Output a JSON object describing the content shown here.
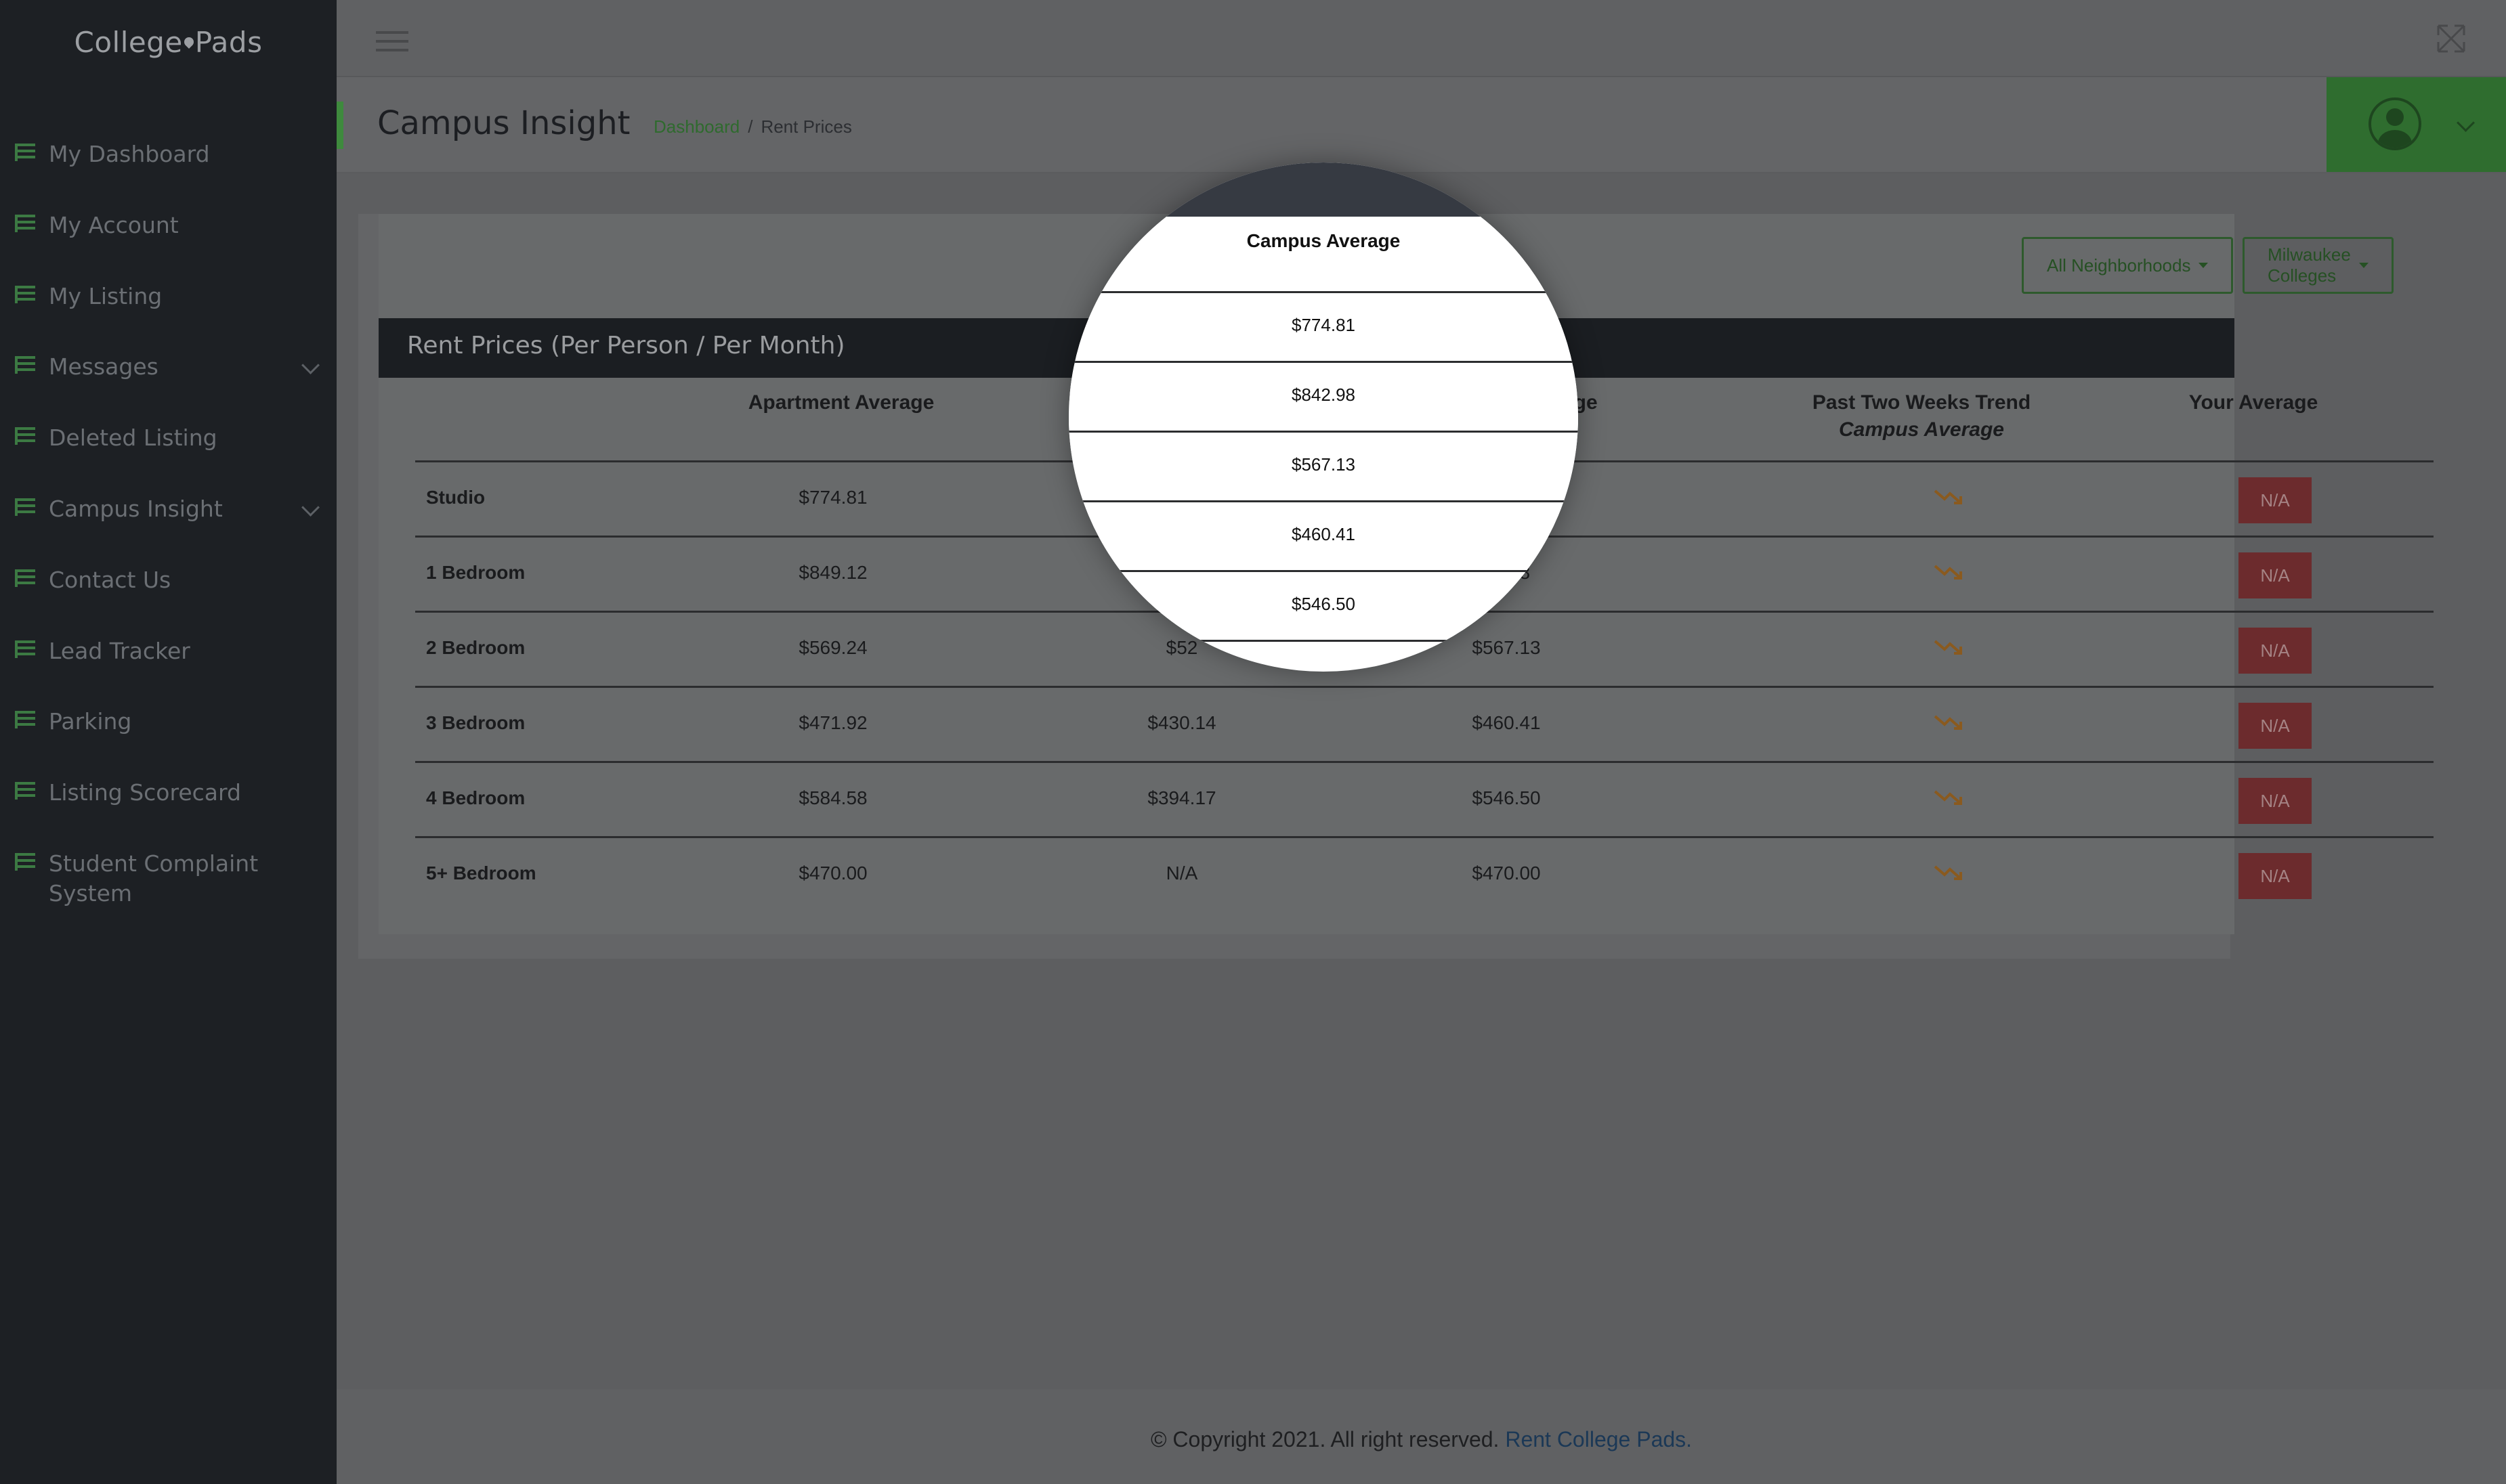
{
  "app": {
    "logo_text_left": "College",
    "logo_text_right": "Pads"
  },
  "sidebar": {
    "items": [
      {
        "label": "My Dashboard",
        "icon": "list-icon",
        "has_chevron": false
      },
      {
        "label": "My Account",
        "icon": "list-icon",
        "has_chevron": false
      },
      {
        "label": "My Listing",
        "icon": "list-icon",
        "has_chevron": false
      },
      {
        "label": "Messages",
        "icon": "list-icon",
        "has_chevron": true
      },
      {
        "label": "Deleted Listing",
        "icon": "list-icon",
        "has_chevron": false
      },
      {
        "label": "Campus Insight",
        "icon": "list-icon",
        "has_chevron": true
      },
      {
        "label": "Contact Us",
        "icon": "list-icon",
        "has_chevron": false
      },
      {
        "label": "Lead Tracker",
        "icon": "list-icon",
        "has_chevron": false
      },
      {
        "label": "Parking",
        "icon": "list-icon",
        "has_chevron": false
      },
      {
        "label": "Listing Scorecard",
        "icon": "list-icon",
        "has_chevron": false
      },
      {
        "label": "Student Complaint System",
        "icon": "list-icon",
        "has_chevron": false
      }
    ]
  },
  "header": {
    "title": "Campus Insight",
    "breadcrumb_link": "Dashboard",
    "breadcrumb_sep": "/",
    "breadcrumb_current": "Rent Prices"
  },
  "filters": {
    "neighborhoods": "All Neighborhoods",
    "colleges": "Milwaukee Colleges"
  },
  "table": {
    "title": "Rent Prices (Per Person / Per Month)",
    "columns": {
      "apartment": "Apartment Average",
      "campus_partial": "rage",
      "trend_line1": "Past Two Weeks Trend",
      "trend_line2": "Campus Average",
      "yours": "Your Average"
    },
    "rows": [
      {
        "label": "Studio",
        "apartment": "$774.81",
        "third": "",
        "campus": "1",
        "yours": "N/A"
      },
      {
        "label": "1 Bedroom",
        "apartment": "$849.12",
        "third": "",
        "campus": "42.98",
        "yours": "N/A"
      },
      {
        "label": "2 Bedroom",
        "apartment": "$569.24",
        "third": "$52",
        "campus": "$567.13",
        "yours": "N/A"
      },
      {
        "label": "3 Bedroom",
        "apartment": "$471.92",
        "third": "$430.14",
        "campus": "$460.41",
        "yours": "N/A"
      },
      {
        "label": "4 Bedroom",
        "apartment": "$584.58",
        "third": "$394.17",
        "campus": "$546.50",
        "yours": "N/A"
      },
      {
        "label": "5+ Bedroom",
        "apartment": "$470.00",
        "third": "N/A",
        "campus": "$470.00",
        "yours": "N/A"
      }
    ]
  },
  "magnifier": {
    "header": "Campus Average",
    "values": [
      "$774.81",
      "$842.98",
      "$567.13",
      "$460.41",
      "$546.50"
    ]
  },
  "footer": {
    "text": "© Copyright 2021. All right reserved.",
    "brand": "Rent College Pads",
    "period": "."
  },
  "colors": {
    "accent_green": "#3e8a3d",
    "badge_red": "#6c2b2d",
    "trend_orange": "#8a5a1f"
  }
}
